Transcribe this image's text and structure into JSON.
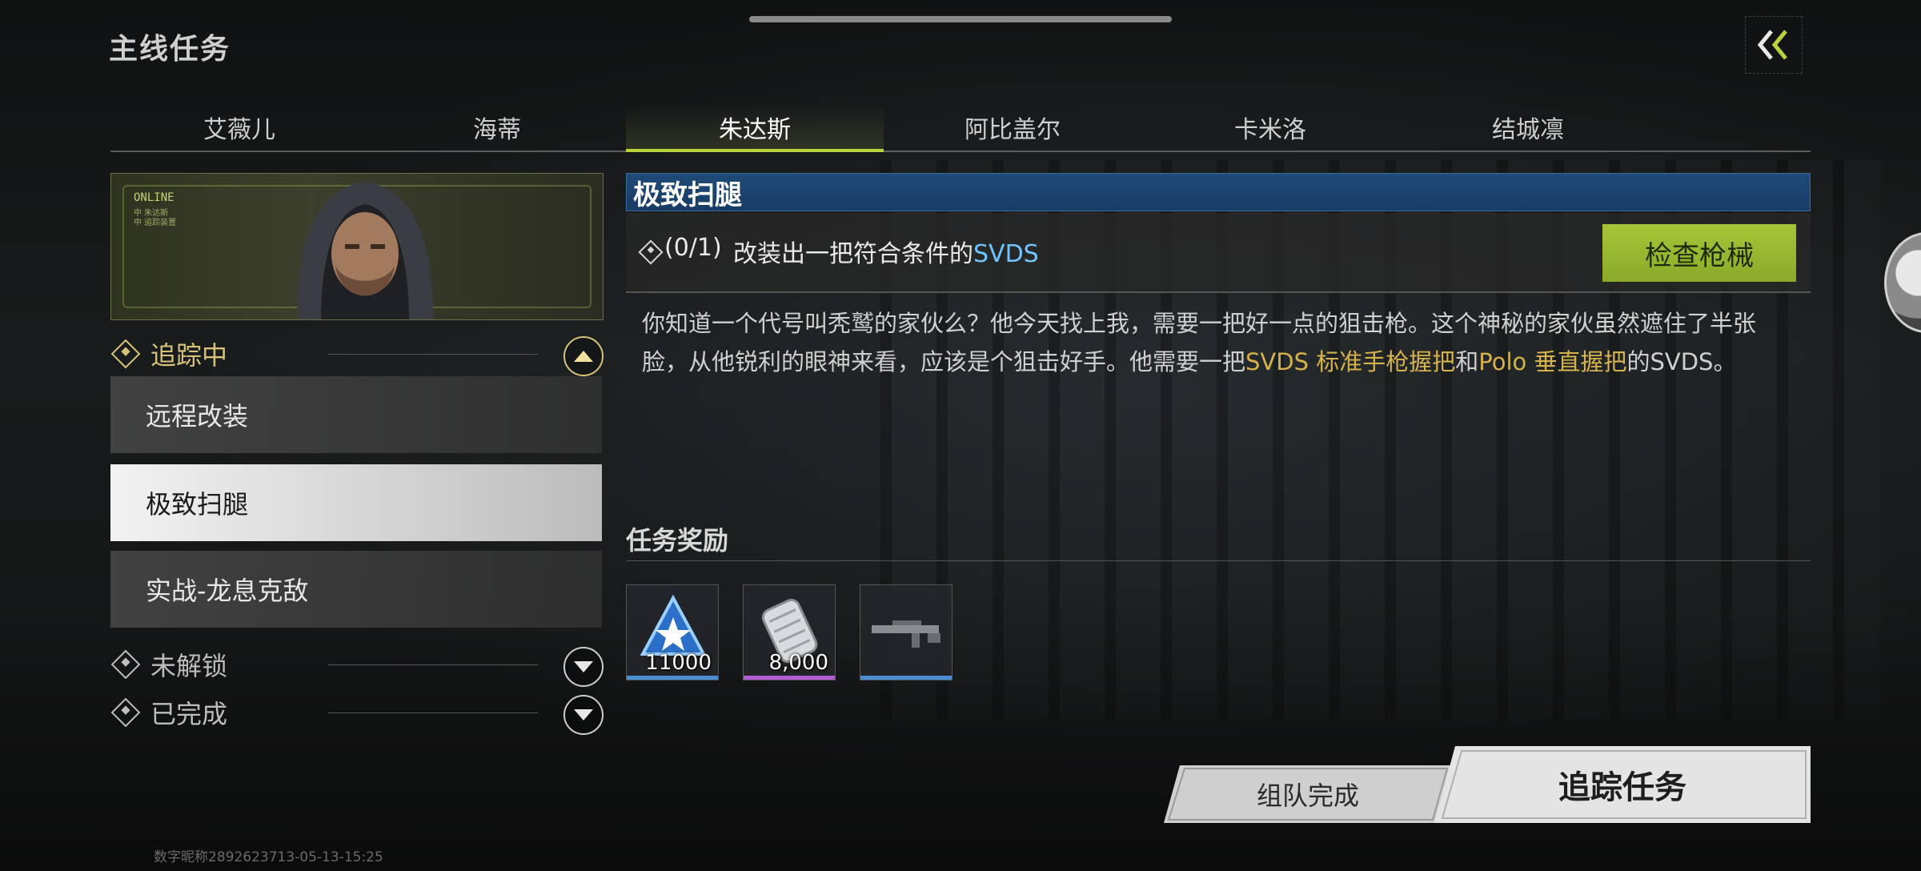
{
  "page": {
    "title": "主线任务"
  },
  "tabs": [
    {
      "label": "艾薇儿",
      "active": false
    },
    {
      "label": "海蒂",
      "active": false
    },
    {
      "label": "朱达斯",
      "active": true
    },
    {
      "label": "阿比盖尔",
      "active": false
    },
    {
      "label": "卡米洛",
      "active": false
    },
    {
      "label": "结城凛",
      "active": false
    }
  ],
  "portrait": {
    "status": "ONLINE",
    "sub_line1": "中 朱达斯",
    "sub_line2": "中 追踪装置"
  },
  "sections": {
    "tracking": {
      "label": "追踪中"
    },
    "locked": {
      "label": "未解锁"
    },
    "completed": {
      "label": "已完成"
    }
  },
  "quests": [
    {
      "label": "远程改装",
      "selected": false
    },
    {
      "label": "极致扫腿",
      "selected": true
    },
    {
      "label": "实战-龙息克敌",
      "selected": false
    }
  ],
  "detail": {
    "title": "极致扫腿",
    "progress": "(0/1)",
    "objective_prefix": "改装出一把符合条件的",
    "objective_highlight": "SVDS",
    "check_button": "检查枪械",
    "desc_part1": "你知道一个代号叫秃鹫的家伙么？他今天找上我，需要一把好一点的狙击枪。这个神秘的家伙虽然遮住了半张脸，从他锐利的眼神来看，应该是个狙击好手。他需要一把",
    "desc_gold1": "SVDS 标准手枪握把",
    "desc_part2": "和",
    "desc_gold2": "Polo 垂直握把",
    "desc_part3": "的SVDS。"
  },
  "rewards": {
    "header": "任务奖励",
    "items": [
      {
        "icon": "star-badge-icon",
        "quantity": "11000",
        "rarity_color": "#4a8fd6"
      },
      {
        "icon": "cash-roll-icon",
        "quantity": "8,000",
        "rarity_color": "#b35cd6"
      },
      {
        "icon": "rifle-icon",
        "quantity": "",
        "rarity_color": "#4a8fd6"
      }
    ]
  },
  "buttons": {
    "team_complete": "组队完成",
    "track_quest": "追踪任务"
  },
  "watermark": "数字昵称2892623713-05-13-15:25",
  "colors": {
    "accent": "#b8d43b",
    "title_bar": "#1f4a78",
    "highlight_blue": "#6fc4ff",
    "highlight_gold": "#d6b24c"
  }
}
